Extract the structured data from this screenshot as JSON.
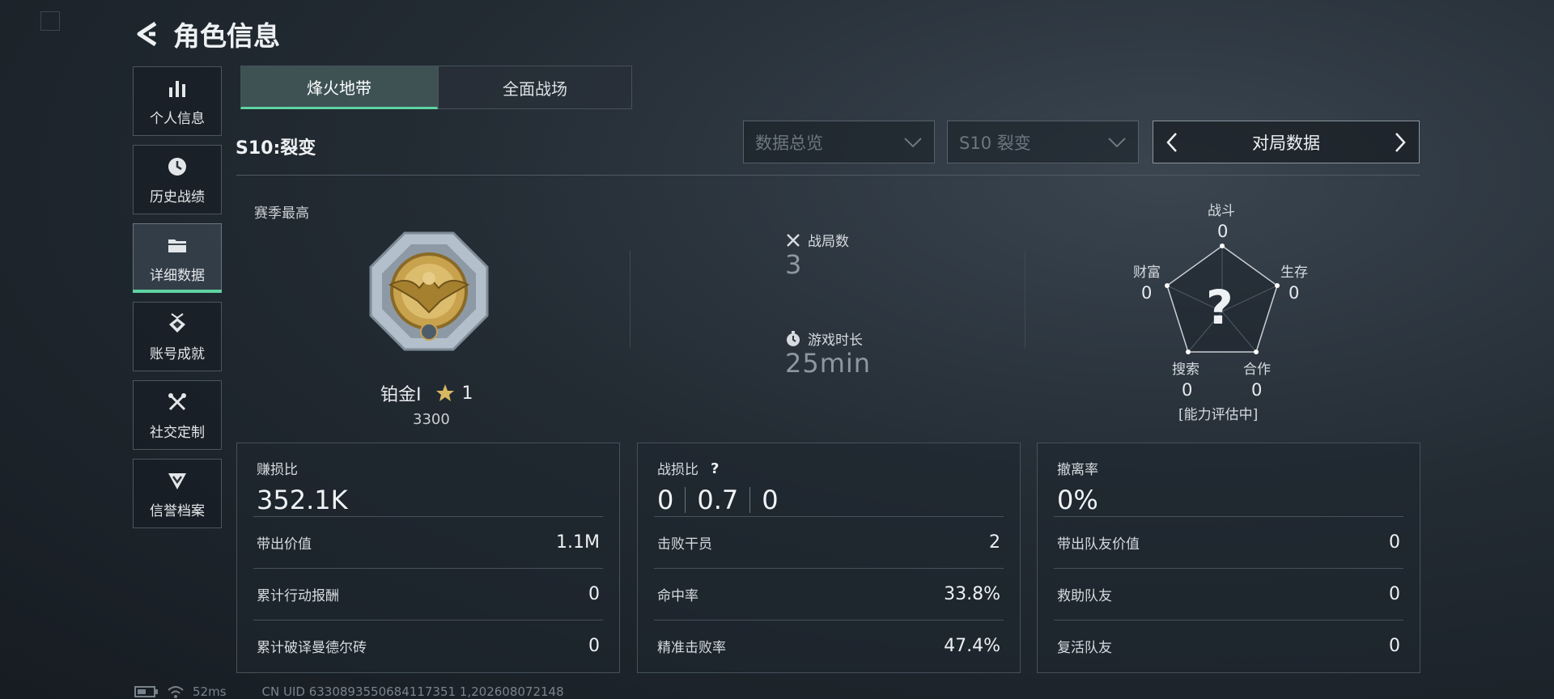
{
  "header": {
    "title": "角色信息"
  },
  "sidebar": {
    "items": [
      {
        "label": "个人信息",
        "icon": "bar-chart-icon"
      },
      {
        "label": "历史战绩",
        "icon": "clock-icon"
      },
      {
        "label": "详细数据",
        "icon": "folder-icon",
        "active": true
      },
      {
        "label": "账号成就",
        "icon": "medal-icon"
      },
      {
        "label": "社交定制",
        "icon": "wrench-icon"
      },
      {
        "label": "信誉档案",
        "icon": "shield-badge-icon"
      }
    ]
  },
  "tabs": [
    {
      "label": "烽火地带",
      "active": true
    },
    {
      "label": "全面战场",
      "active": false
    }
  ],
  "season_label": "S10:裂变",
  "filters": {
    "view": "数据总览",
    "season": "S10 裂变"
  },
  "pager": {
    "label": "对局数据"
  },
  "rank": {
    "heading": "赛季最高",
    "name": "铂金Ⅰ",
    "stars": "1",
    "score": "3300"
  },
  "stats": {
    "matches_label": "战局数",
    "matches_value": "3",
    "playtime_label": "游戏时长",
    "playtime_value": "25min"
  },
  "radar": {
    "center_symbol": "?",
    "status": "[能力评估中]",
    "axes": [
      {
        "label": "战斗",
        "value": "0"
      },
      {
        "label": "生存",
        "value": "0"
      },
      {
        "label": "合作",
        "value": "0"
      },
      {
        "label": "搜索",
        "value": "0"
      },
      {
        "label": "财富",
        "value": "0"
      }
    ]
  },
  "cards": [
    {
      "title": "赚损比",
      "value": "352.1K",
      "rows": [
        {
          "label": "带出价值",
          "value": "1.1M"
        },
        {
          "label": "累计行动报酬",
          "value": "0"
        },
        {
          "label": "累计破译曼德尔砖",
          "value": "0"
        }
      ]
    },
    {
      "title": "战损比",
      "ratio": [
        "0",
        "0.7",
        "0"
      ],
      "rows": [
        {
          "label": "击败干员",
          "value": "2"
        },
        {
          "label": "命中率",
          "value": "33.8%"
        },
        {
          "label": "精准击败率",
          "value": "47.4%"
        }
      ]
    },
    {
      "title": "撤离率",
      "value": "0%",
      "rows": [
        {
          "label": "带出队友价值",
          "value": "0"
        },
        {
          "label": "救助队友",
          "value": "0"
        },
        {
          "label": "复活队友",
          "value": "0"
        }
      ]
    }
  ],
  "footer": {
    "ping": "52ms",
    "uid": "CN UID 6330893550684117351 1,202608072148"
  },
  "colors": {
    "accent": "#5fd3a2",
    "badge_gold": "#c9a24e"
  }
}
